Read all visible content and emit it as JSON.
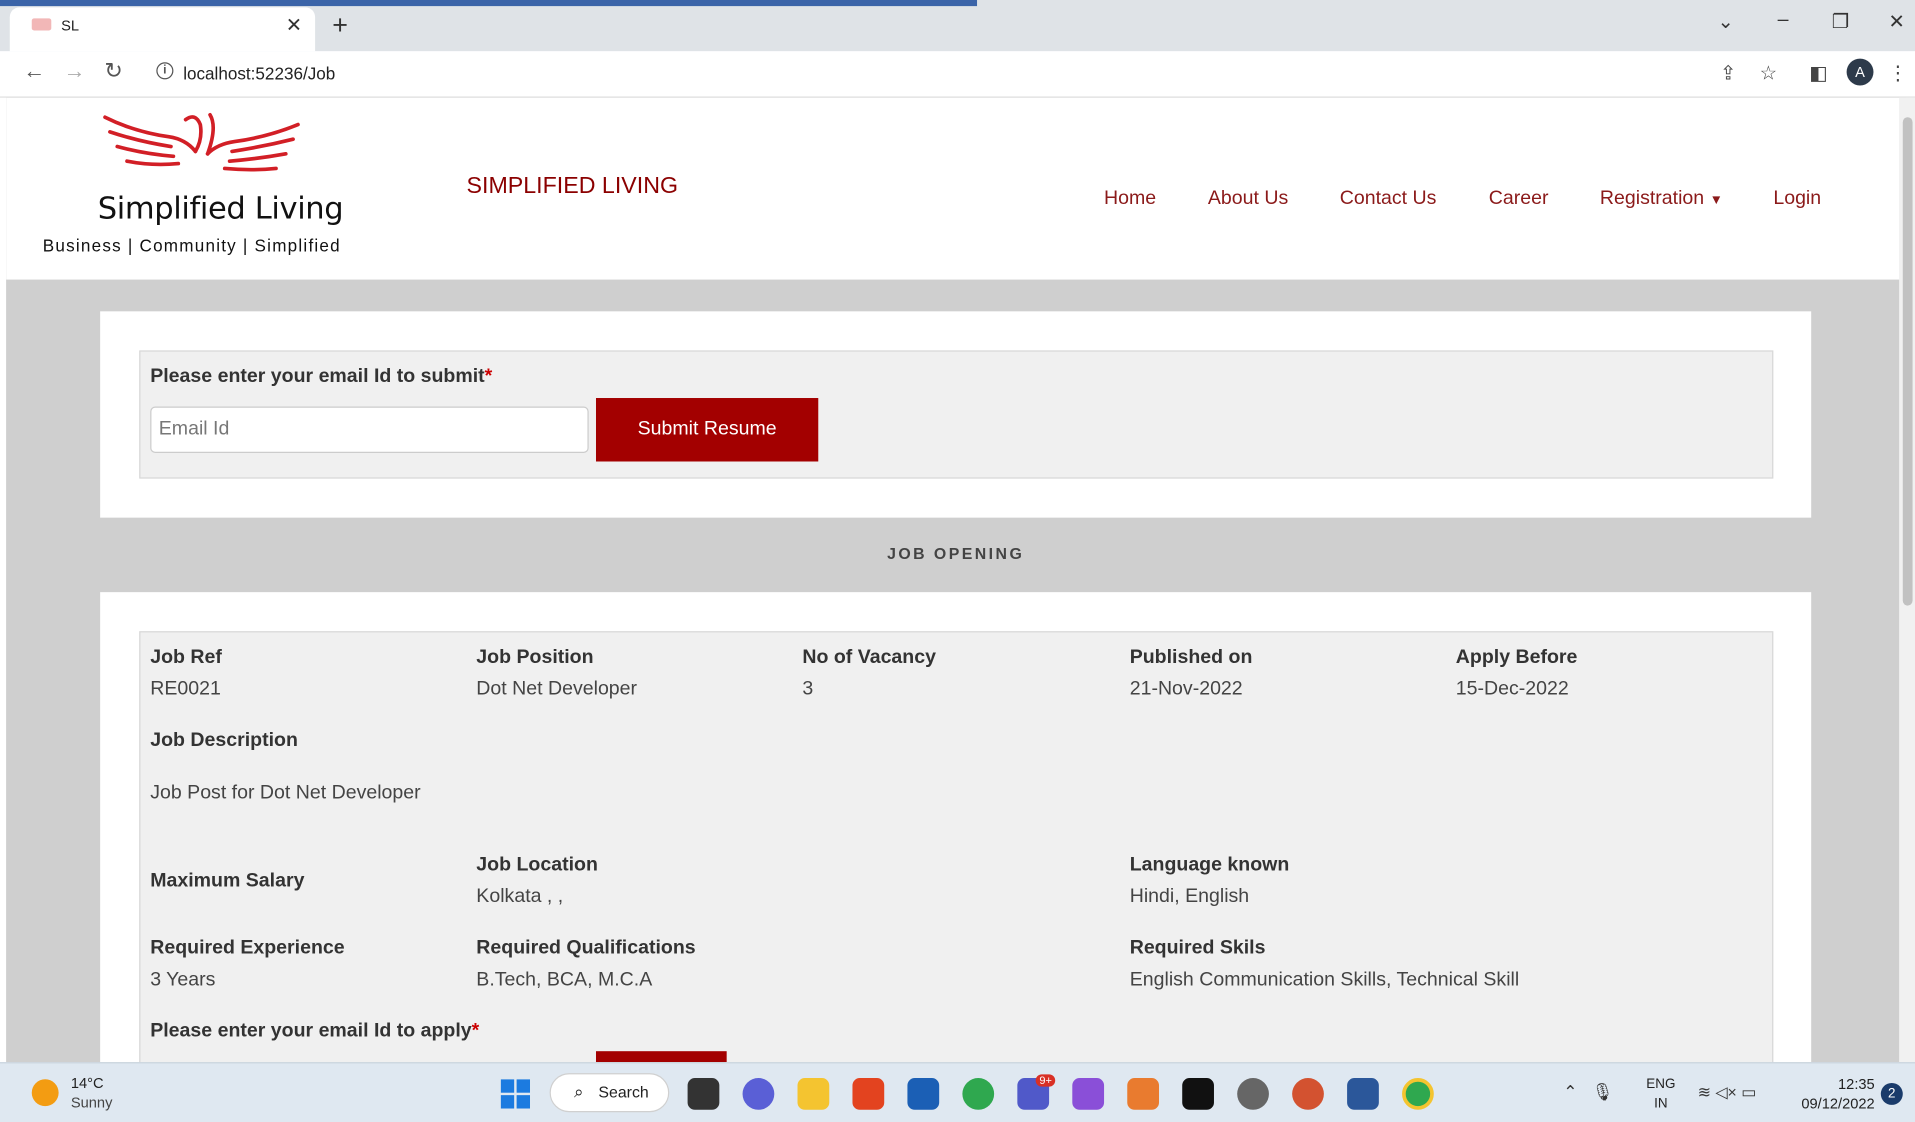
{
  "browser": {
    "tab_title": "SL",
    "url": "localhost:52236/Job",
    "avatar_letter": "A"
  },
  "header": {
    "logo_name": "Simplified Living",
    "logo_tagline": "Business | Community | Simplified",
    "brand": "SIMPLIFIED LIVING",
    "nav": [
      "Home",
      "About Us",
      "Contact Us",
      "Career",
      "Registration",
      "Login"
    ],
    "accent_color": "#8b1a1a"
  },
  "email_section": {
    "label": "Please enter your email Id to submit",
    "required_mark": "*",
    "placeholder": "Email Id",
    "value": "",
    "button": "Submit Resume"
  },
  "job_heading": "JOB OPENING",
  "job": {
    "ref_label": "Job Ref",
    "ref": "RE0021",
    "position_label": "Job Position",
    "position": "Dot Net Developer",
    "vacancy_label": "No of Vacancy",
    "vacancy": "3",
    "published_label": "Published on",
    "published": "21-Nov-2022",
    "apply_before_label": "Apply Before",
    "apply_before": "15-Dec-2022",
    "description_label": "Job Description",
    "description": "Job Post for Dot Net Developer",
    "salary_label": "Maximum Salary",
    "location_label": "Job Location",
    "location": "Kolkata , ,",
    "language_label": "Language known",
    "language": "Hindi, English",
    "experience_label": "Required Experience",
    "experience": "3 Years",
    "qualifications_label": "Required Qualifications",
    "qualifications": "B.Tech, BCA, M.C.A",
    "skills_label": "Required Skils",
    "skills": "English Communication Skills, Technical Skill",
    "apply_label": "Please enter your email Id to apply",
    "apply_required_mark": "*"
  },
  "taskbar": {
    "temperature": "14°C",
    "condition": "Sunny",
    "search": "Search",
    "language": "ENG",
    "region": "IN",
    "time": "12:35",
    "date": "09/12/2022",
    "notification_count": "2",
    "badge": "9+"
  }
}
